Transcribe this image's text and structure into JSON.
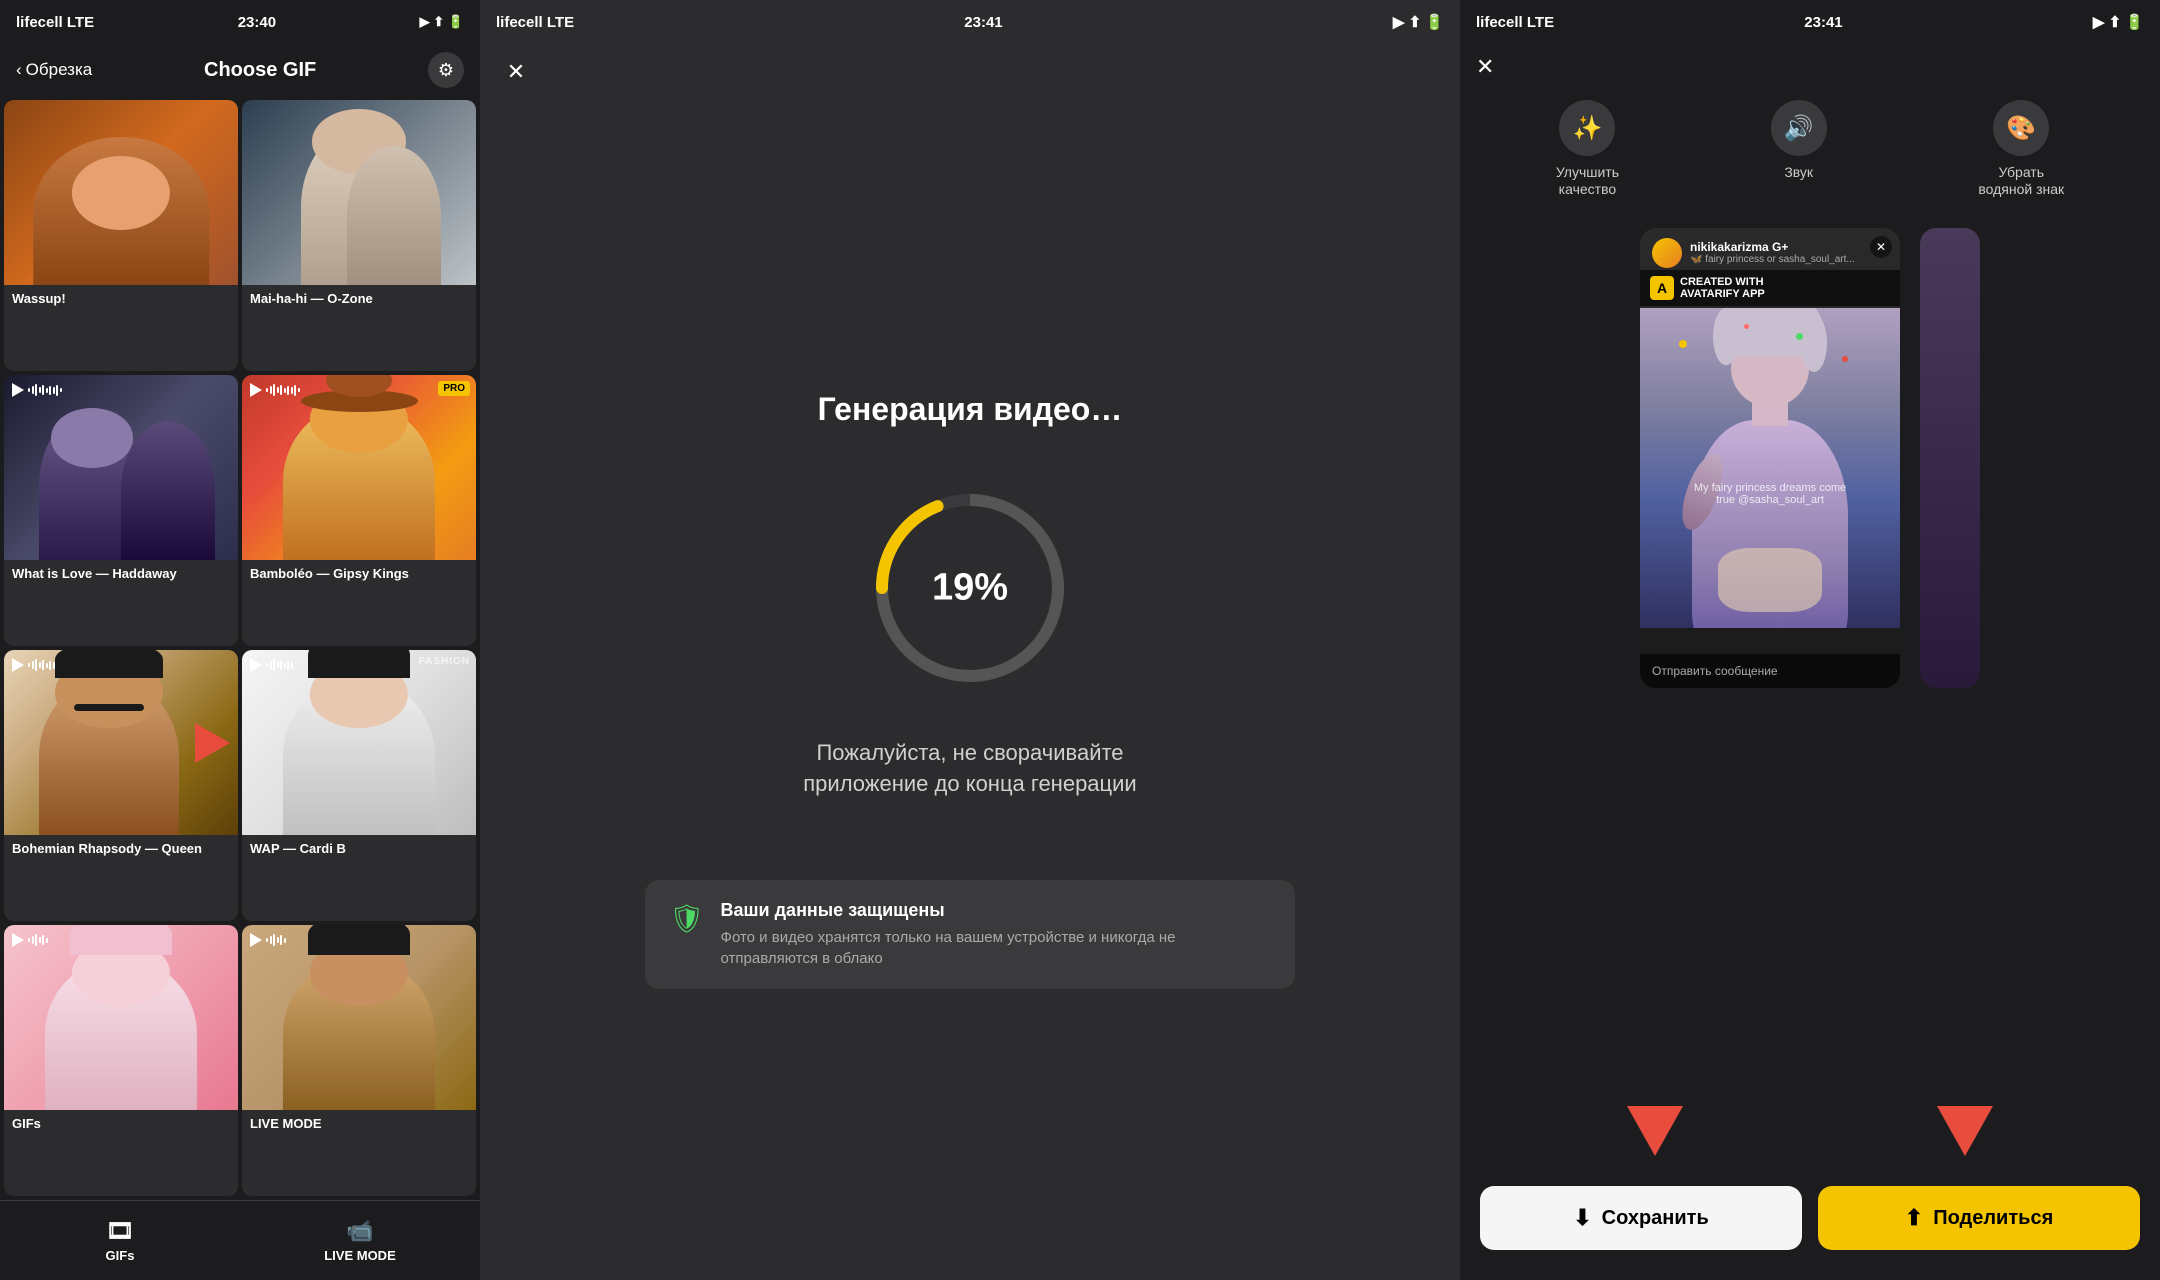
{
  "panels": {
    "panel1": {
      "statusBar": {
        "carrier": "lifecell  LTE",
        "time": "23:40",
        "icons": "▶ ⬆ 🔋"
      },
      "navBack": "Обрезка",
      "navTitle": "Choose GIF",
      "gifs": [
        {
          "id": "wassup",
          "label": "Wassup!",
          "thumb": "wassup",
          "hasPlay": false
        },
        {
          "id": "mai-ha-hi",
          "label": "Mai-ha-hi — O-Zone",
          "thumb": "mai",
          "hasPlay": false
        },
        {
          "id": "what-is-love",
          "label": "What is Love — Haddaway",
          "thumb": "whatlove",
          "hasPlay": true
        },
        {
          "id": "bamboleo",
          "label": "Bamboléo — Gipsy Kings",
          "thumb": "bamboleo",
          "hasPlay": true,
          "pro": true
        },
        {
          "id": "bohemian",
          "label": "Bohemian Rhapsody — Queen",
          "thumb": "bohemian",
          "hasPlay": true,
          "arrow": true
        },
        {
          "id": "wap",
          "label": "WAP — Cardi B",
          "thumb": "wap",
          "hasPlay": true,
          "fashion": "FASHION"
        },
        {
          "id": "gifs",
          "label": "GIFs",
          "thumb": "gifs",
          "hasPlay": true
        },
        {
          "id": "live",
          "label": "LIVE MODE",
          "thumb": "live",
          "hasPlay": true
        }
      ],
      "bottomTabs": [
        {
          "id": "gifs-tab",
          "label": "GIFs",
          "icon": "🎞"
        },
        {
          "id": "live-tab",
          "label": "LIVE MODE",
          "icon": "📹"
        }
      ]
    },
    "panel2": {
      "statusBar": {
        "carrier": "lifecell  LTE",
        "time": "23:41"
      },
      "title": "Генерация видео…",
      "progress": "19%",
      "progressValue": 19,
      "subtitle": "Пожалуйста, не сворачивайте\nприложение до конца генерации",
      "securityTitle": "Ваши данные защищены",
      "securityText": "Фото и видео хранятся только на вашем устройстве и никогда не отправляются в облако"
    },
    "panel3": {
      "statusBar": {
        "carrier": "lifecell  LTE",
        "time": "23:41"
      },
      "toolbar": [
        {
          "id": "enhance",
          "label": "Улучшить\nкачество",
          "icon": "✨"
        },
        {
          "id": "sound",
          "label": "Звук",
          "icon": "🔊"
        },
        {
          "id": "watermark",
          "label": "Убрать\nводяной знак",
          "icon": "🎨"
        }
      ],
      "video": {
        "username": "nikikakarizma G+",
        "subtitle": "🦋 fairy princess or sasha_soul_art...",
        "watermarkText": "CREATED WITH\nAVATARIFY APP",
        "footerText": "Отправить сообщение",
        "bottomText": "My fairy princess dreams come true @sasha_soul_art"
      },
      "buttons": {
        "save": "Сохранить",
        "share": "Поделиться"
      }
    }
  }
}
